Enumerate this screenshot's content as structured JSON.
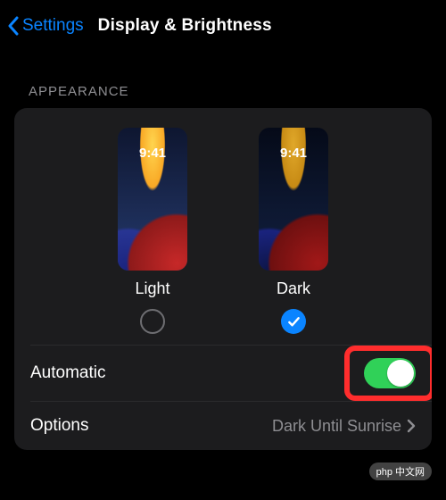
{
  "nav": {
    "back_label": "Settings",
    "title": "Display & Brightness"
  },
  "appearance": {
    "header": "APPEARANCE",
    "preview_time": "9:41",
    "light_label": "Light",
    "dark_label": "Dark",
    "light_selected": false,
    "dark_selected": true
  },
  "rows": {
    "automatic": {
      "label": "Automatic",
      "value": true
    },
    "options": {
      "label": "Options",
      "detail": "Dark Until Sunrise"
    }
  },
  "watermark": "php 中文网",
  "colors": {
    "accent": "#0a84ff",
    "toggle_on": "#30d158",
    "highlight": "#ff2d2d"
  }
}
